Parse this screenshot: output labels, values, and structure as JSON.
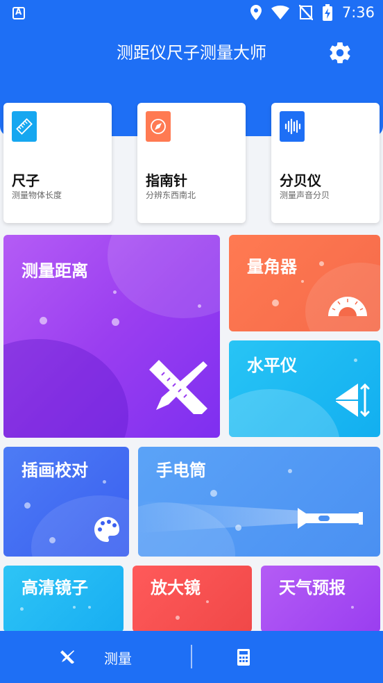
{
  "status_bar": {
    "time": "7:36"
  },
  "header": {
    "title": "测距仪尺子测量大师"
  },
  "tools": [
    {
      "title": "尺子",
      "subtitle": "测量物体长度",
      "icon": "ruler-icon",
      "color": "#16a7f0"
    },
    {
      "title": "指南针",
      "subtitle": "分辨东西南北",
      "icon": "compass-icon",
      "color": "#ff7a52"
    },
    {
      "title": "分贝仪",
      "subtitle": "测量声音分贝",
      "icon": "sound-wave-icon",
      "color": "#1e6ff5"
    }
  ],
  "tiles": {
    "distance": "测量距离",
    "protractor": "量角器",
    "level": "水平仪",
    "illustration": "插画校对",
    "flashlight": "手电筒",
    "mirror": "高清镜子",
    "magnifier": "放大镜",
    "weather": "天气预报"
  },
  "bottom_nav": {
    "tab_measure": "测量"
  }
}
